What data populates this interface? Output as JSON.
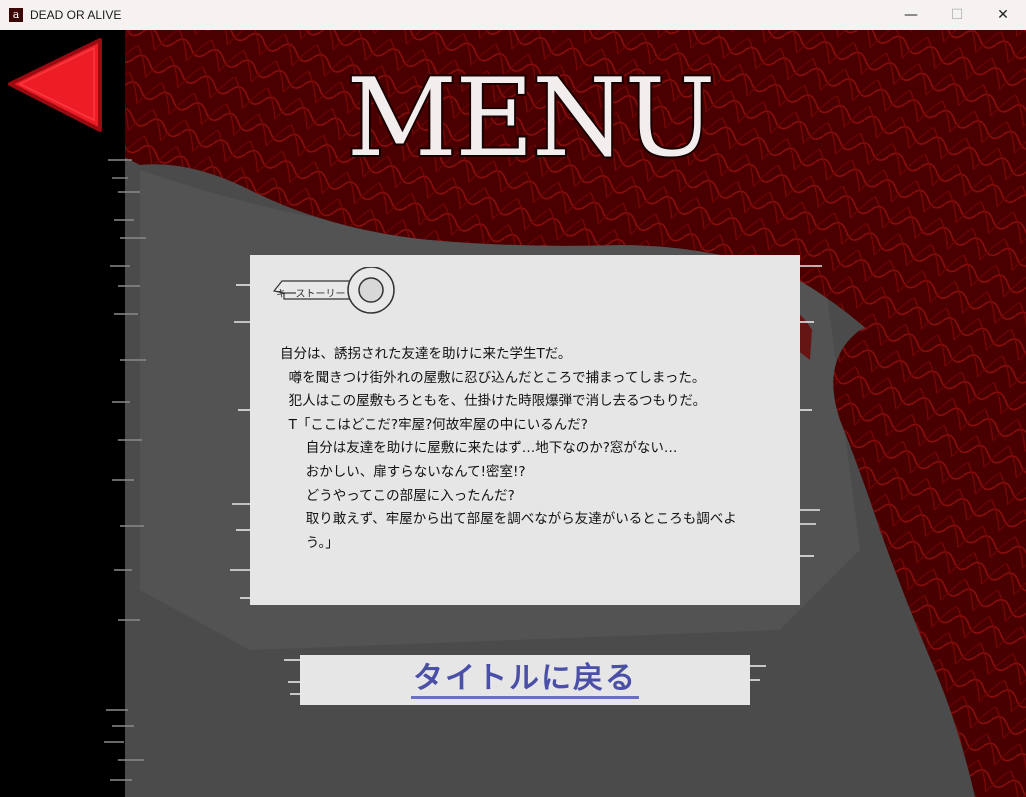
{
  "window": {
    "title": "DEAD OR ALIVE",
    "icon_letter": "a",
    "controls": {
      "minimize": "—",
      "maximize": "☐",
      "close": "✕"
    }
  },
  "colors": {
    "blood": "#5a0000",
    "arrow": "#ee1c25",
    "button_text": "#4a4fa8"
  },
  "menu": {
    "title": "MENU",
    "back_icon": "red-arrow-left-icon"
  },
  "story": {
    "key_label": "キーストーリー",
    "lines": [
      "自分は、誘拐された友達を助けに来た学生Tだ。",
      "  噂を聞きつけ街外れの屋敷に忍び込んだところで捕まってしまった。",
      "  犯人はこの屋敷もろともを、仕掛けた時限爆弾で消し去るつもりだ。",
      "  T「ここはどこだ?牢屋?何故牢屋の中にいるんだ?",
      "      自分は友達を助けに屋敷に来たはず…地下なのか?窓がない…",
      "      おかしい、扉すらないなんて!密室!?",
      "      どうやってこの部屋に入ったんだ?",
      "      取り敢えず、牢屋から出て部屋を調べながら友達がいるところも調べよ",
      "      う。」"
    ]
  },
  "buttons": {
    "return_title": "タイトルに戻る"
  }
}
